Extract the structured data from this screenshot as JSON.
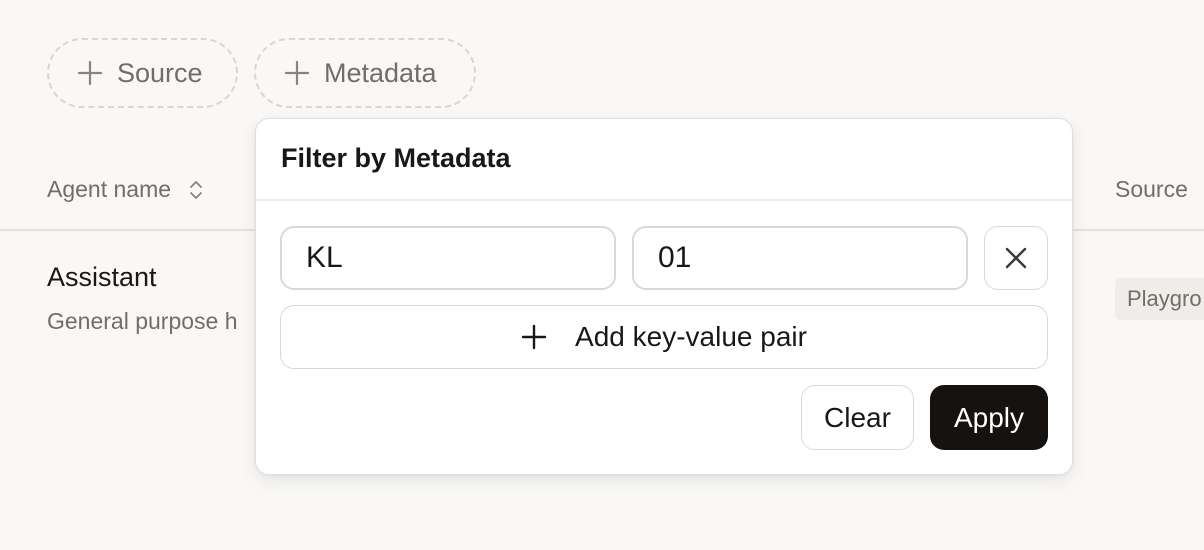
{
  "filters": {
    "source_label": "Source",
    "metadata_label": "Metadata"
  },
  "table": {
    "columns": {
      "agent_name": "Agent name",
      "source": "Source"
    },
    "rows": [
      {
        "name": "Assistant",
        "description": "General purpose h",
        "source": "Playgro"
      }
    ]
  },
  "popover": {
    "title": "Filter by Metadata",
    "pairs": [
      {
        "key": "KL",
        "value": "01"
      }
    ],
    "add_pair_label": "Add key-value pair",
    "clear_label": "Clear",
    "apply_label": "Apply"
  },
  "icons": {
    "chip_icon": "plus-icon",
    "sort_icon": "sort-chevrons-icon",
    "remove_icon": "close-icon",
    "add_icon": "plus-icon"
  },
  "colors": {
    "background": "#f9f8f6",
    "primary_button": "#16120f",
    "muted_text": "#736d66"
  }
}
